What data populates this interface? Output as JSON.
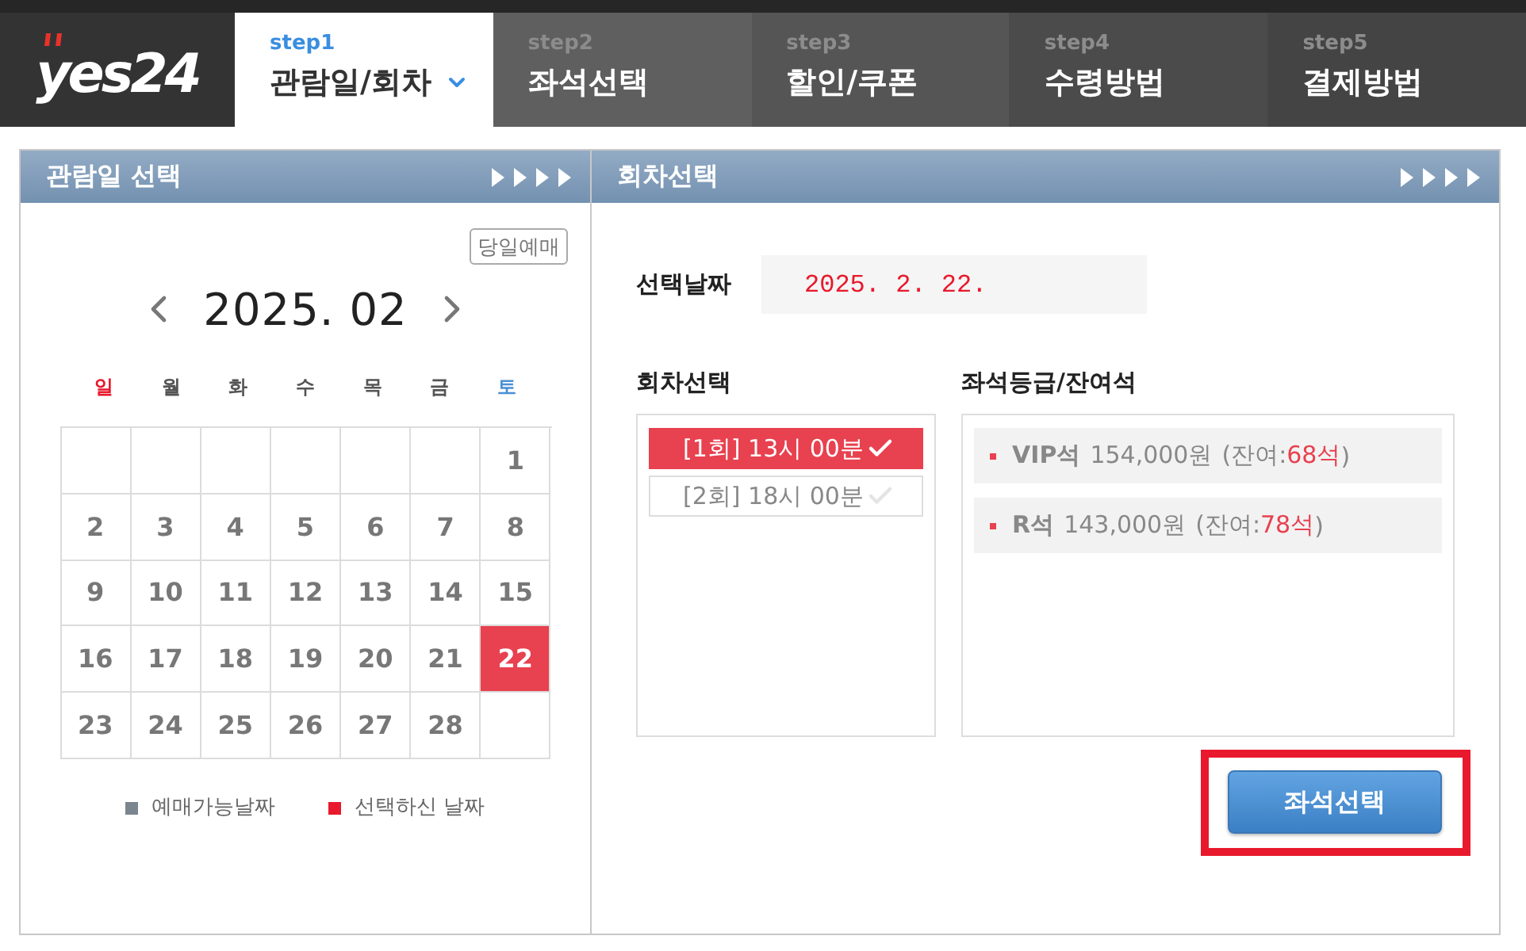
{
  "logo": {
    "text": "yes24"
  },
  "steps": [
    {
      "step": "step1",
      "label": "관람일/회차",
      "selected": true
    },
    {
      "step": "step2",
      "label": "좌석선택",
      "selected": false
    },
    {
      "step": "step3",
      "label": "할인/쿠폰",
      "selected": false
    },
    {
      "step": "step4",
      "label": "수령방법",
      "selected": false
    },
    {
      "step": "step5",
      "label": "결제방법",
      "selected": false
    }
  ],
  "date_panel": {
    "title": "관람일 선택",
    "today_button": "당일예매",
    "month": "2025. 02",
    "weekdays": [
      {
        "label": "일",
        "color": "#e8192c"
      },
      {
        "label": "월",
        "color": "#555555"
      },
      {
        "label": "화",
        "color": "#555555"
      },
      {
        "label": "수",
        "color": "#555555"
      },
      {
        "label": "목",
        "color": "#555555"
      },
      {
        "label": "금",
        "color": "#555555"
      },
      {
        "label": "토",
        "color": "#4a8fd6"
      }
    ],
    "weeks": [
      [
        {
          "kind": "blank"
        },
        {
          "kind": "blank"
        },
        {
          "kind": "blank"
        },
        {
          "kind": "blank"
        },
        {
          "kind": "blank"
        },
        {
          "kind": "blank"
        },
        {
          "kind": "day",
          "day": "1",
          "selected": false
        }
      ],
      [
        {
          "kind": "day",
          "day": "2",
          "selected": false
        },
        {
          "kind": "day",
          "day": "3",
          "selected": false
        },
        {
          "kind": "day",
          "day": "4",
          "selected": false
        },
        {
          "kind": "day",
          "day": "5",
          "selected": false
        },
        {
          "kind": "day",
          "day": "6",
          "selected": false
        },
        {
          "kind": "day",
          "day": "7",
          "selected": false
        },
        {
          "kind": "day",
          "day": "8",
          "selected": false
        }
      ],
      [
        {
          "kind": "day",
          "day": "9",
          "selected": false
        },
        {
          "kind": "day",
          "day": "10",
          "selected": false
        },
        {
          "kind": "day",
          "day": "11",
          "selected": false
        },
        {
          "kind": "day",
          "day": "12",
          "selected": false
        },
        {
          "kind": "day",
          "day": "13",
          "selected": false
        },
        {
          "kind": "day",
          "day": "14",
          "selected": false
        },
        {
          "kind": "day",
          "day": "15",
          "selected": false
        }
      ],
      [
        {
          "kind": "day",
          "day": "16",
          "selected": false
        },
        {
          "kind": "day",
          "day": "17",
          "selected": false
        },
        {
          "kind": "day",
          "day": "18",
          "selected": false
        },
        {
          "kind": "day",
          "day": "19",
          "selected": false
        },
        {
          "kind": "day",
          "day": "20",
          "selected": false
        },
        {
          "kind": "day",
          "day": "21",
          "selected": false
        },
        {
          "kind": "day",
          "day": "22",
          "selected": true
        }
      ],
      [
        {
          "kind": "day",
          "day": "23",
          "selected": false
        },
        {
          "kind": "day",
          "day": "24",
          "selected": false
        },
        {
          "kind": "day",
          "day": "25",
          "selected": false
        },
        {
          "kind": "day",
          "day": "26",
          "selected": false
        },
        {
          "kind": "day",
          "day": "27",
          "selected": false
        },
        {
          "kind": "day",
          "day": "28",
          "selected": false
        },
        {
          "kind": "blank"
        }
      ]
    ],
    "legend": [
      {
        "label": "예매가능날짜",
        "color": "#7b8590"
      },
      {
        "label": "선택하신 날짜",
        "color": "#e8192c"
      }
    ]
  },
  "session_panel": {
    "title": "회차선택",
    "date_label": "선택날짜",
    "date_value": "2025. 2. 22.",
    "sessions_heading": "회차선택",
    "sessions": [
      {
        "label": "[1회] 13시 00분",
        "selected": true
      },
      {
        "label": "[2회] 18시 00분",
        "selected": false
      }
    ],
    "seats_heading": "좌석등급/잔여석",
    "seat_grades": [
      {
        "grade": "VIP석",
        "price": "154,000원",
        "remaining_open": "(잔여:",
        "remaining": "68석",
        "remaining_close": ")"
      },
      {
        "grade": "R석",
        "price": "143,000원",
        "remaining_open": "(잔여:",
        "remaining": "78석",
        "remaining_close": ")"
      }
    ],
    "seat_button": {
      "label": "좌석선택",
      "highlighted": true
    }
  }
}
